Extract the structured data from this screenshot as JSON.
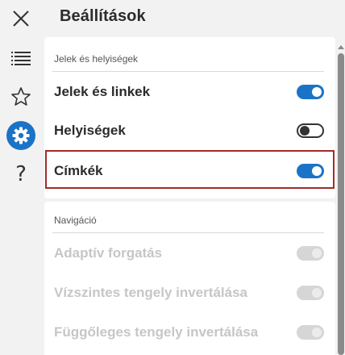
{
  "header": {
    "title": "Beállítások"
  },
  "rail": {
    "icons": [
      "close-icon",
      "list-icon",
      "star-icon",
      "gear-icon",
      "help-icon"
    ],
    "help_glyph": "?"
  },
  "sections": {
    "signs": {
      "label": "Jelek és helyiségek",
      "items": [
        {
          "label": "Jelek és linkek",
          "state": "on"
        },
        {
          "label": "Helyiségek",
          "state": "off"
        },
        {
          "label": "Címkék",
          "state": "on"
        }
      ]
    },
    "navigation": {
      "label": "Navigáció",
      "items": [
        {
          "label": "Adaptív forgatás",
          "state": "disabled"
        },
        {
          "label": "Vízszintes tengely invertálása",
          "state": "disabled"
        },
        {
          "label": "Függőleges tengely invertálása",
          "state": "disabled"
        }
      ]
    }
  },
  "colors": {
    "accent": "#1a73c6",
    "highlight_border": "#a12b2b",
    "background": "#f2f2f2",
    "disabled_text": "#c6c6c6"
  }
}
